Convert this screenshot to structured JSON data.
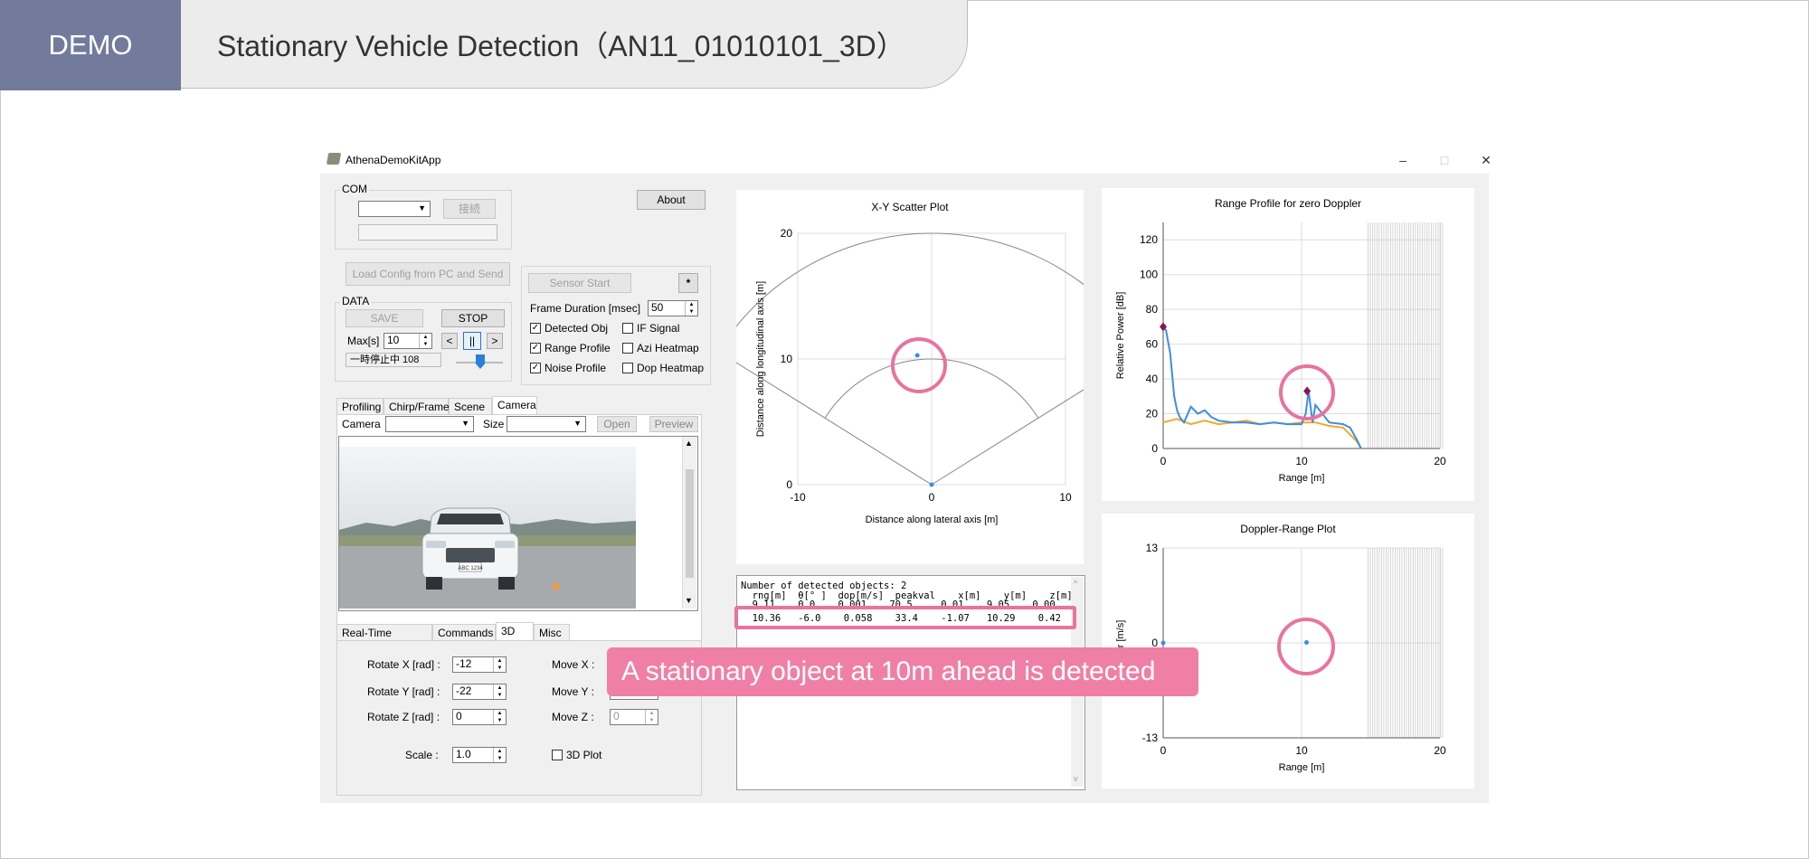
{
  "header": {
    "badge": "DEMO",
    "title": "Stationary Vehicle Detection（AN11_01010101_3D）"
  },
  "window": {
    "title": "AthenaDemoKitApp",
    "minimize": "–",
    "maximize": "□",
    "close": "✕"
  },
  "com": {
    "label": "COM",
    "connect": "接続",
    "about": "About"
  },
  "config": {
    "load": "Load Config from PC and Send",
    "sensor_start": "Sensor Start",
    "star": "*",
    "frame_duration_label": "Frame Duration [msec]",
    "frame_duration_value": "50"
  },
  "data_group": {
    "label": "DATA",
    "save": "SAVE",
    "stop": "STOP",
    "max_label": "Max[s]",
    "max_value": "10",
    "prev": "<",
    "pause": "||",
    "next": ">",
    "status": "一時停止中 108"
  },
  "checks": [
    {
      "label": "Detected Obj",
      "checked": true
    },
    {
      "label": "IF Signal",
      "checked": false
    },
    {
      "label": "Range Profile",
      "checked": true
    },
    {
      "label": "Azi Heatmap",
      "checked": false
    },
    {
      "label": "Noise Profile",
      "checked": true
    },
    {
      "label": "Dop Heatmap",
      "checked": false
    }
  ],
  "tabs_top": [
    "Profiling",
    "Chirp/Frame",
    "Scene",
    "Camera"
  ],
  "camera": {
    "label": "Camera",
    "size_label": "Size",
    "open": "Open",
    "preview": "Preview",
    "plate": "ABC 1234"
  },
  "tabs_bottom": [
    "Real-Time Tuning",
    "Commands",
    "3D",
    "Misc"
  ],
  "view3d": {
    "rotate_x": {
      "label": "Rotate X [rad] :",
      "value": "-12"
    },
    "rotate_y": {
      "label": "Rotate Y [rad] :",
      "value": "-22"
    },
    "rotate_z": {
      "label": "Rotate Z [rad] :",
      "value": "0"
    },
    "move_x": {
      "label": "Move X :"
    },
    "move_y": {
      "label": "Move Y :"
    },
    "move_z": {
      "label": "Move Z :",
      "value": "0"
    },
    "scale": {
      "label": "Scale :",
      "value": "1.0"
    },
    "plot3d": "3D Plot"
  },
  "scatter": {
    "title": "X-Y Scatter Plot",
    "xlabel": "Distance along lateral axis [m]",
    "ylabel": "Distance along longitudinal axis [m]",
    "x_ticks": [
      "-10",
      "0",
      "10"
    ],
    "y_ticks": [
      "0",
      "10",
      "20"
    ]
  },
  "range_profile": {
    "title": "Range Profile for zero Doppler",
    "xlabel": "Range [m]",
    "ylabel": "Relative Power [dB]",
    "x_ticks": [
      "0",
      "10",
      "20"
    ],
    "y_ticks": [
      "0",
      "20",
      "40",
      "60",
      "80",
      "100",
      "120"
    ]
  },
  "doppler": {
    "title": "Doppler-Range Plot",
    "xlabel": "Range [m]",
    "ylabel": "r [m/s]",
    "x_ticks": [
      "0",
      "10",
      "20"
    ],
    "y_ticks": [
      "-13",
      "0",
      "13"
    ]
  },
  "objects": {
    "line1": "Number of detected objects: 2",
    "header": "  rng[m]  θ[° ]  dop[m/s]  peakval    x[m]    y[m]    z[m]",
    "row1": "  9.11    0.0    0.001    70.5     0.01    9.05    0.00",
    "row2": "  10.36   -6.0    0.058    33.4    -1.07   10.29    0.42"
  },
  "callout": "A stationary object at 10m ahead is detected",
  "chart_data": [
    {
      "type": "scatter",
      "title": "X-Y Scatter Plot",
      "xlabel": "Distance along lateral axis [m]",
      "ylabel": "Distance along longitudinal axis [m]",
      "xlim": [
        -10,
        10
      ],
      "ylim": [
        0,
        20
      ],
      "points": [
        {
          "x": -1.07,
          "y": 10.29
        },
        {
          "x": 0,
          "y": 0
        }
      ]
    },
    {
      "type": "line",
      "title": "Range Profile for zero Doppler",
      "xlabel": "Range [m]",
      "ylabel": "Relative Power [dB]",
      "xlim": [
        0,
        20
      ],
      "ylim": [
        0,
        130
      ],
      "series": [
        {
          "color": "#3c8ce7",
          "x": [
            0,
            0.2,
            0.5,
            0.8,
            1.0,
            1.2,
            1.5,
            2.0,
            2.5,
            3.0,
            3.5,
            4.0,
            5.0,
            6.0,
            7.0,
            8.0,
            9.0,
            10.0,
            10.3,
            10.5,
            10.8,
            11.0,
            12.0,
            13.0,
            13.5,
            14.0,
            14.3
          ],
          "y": [
            70,
            68,
            55,
            30,
            22,
            18,
            15,
            24,
            20,
            22,
            18,
            16,
            15,
            15,
            14,
            15,
            14,
            14,
            20,
            33,
            15,
            25,
            15,
            14,
            12,
            5,
            0
          ]
        },
        {
          "color": "#f0a92a",
          "x": [
            0,
            1,
            2,
            3,
            4,
            5,
            6,
            7,
            8,
            9,
            10,
            11,
            12,
            13,
            13.5,
            14.0,
            14.3
          ],
          "y": [
            15,
            17,
            14,
            16,
            14,
            15,
            16,
            14,
            15,
            14,
            15,
            15,
            13,
            12,
            8,
            4,
            0
          ]
        }
      ],
      "markers": [
        {
          "x": 0,
          "y": 70
        },
        {
          "x": 10.4,
          "y": 33
        }
      ]
    },
    {
      "type": "scatter",
      "title": "Doppler-Range Plot",
      "xlabel": "Range [m]",
      "ylabel": "r [m/s]",
      "xlim": [
        0,
        20
      ],
      "ylim": [
        -13,
        13
      ],
      "points": [
        {
          "x": 10.36,
          "y": 0.058
        },
        {
          "x": 0,
          "y": 0
        }
      ]
    }
  ],
  "colors": {
    "accent_pink": "#e9739e",
    "badge": "#737b9c",
    "point_blue": "#3c8ce7"
  }
}
